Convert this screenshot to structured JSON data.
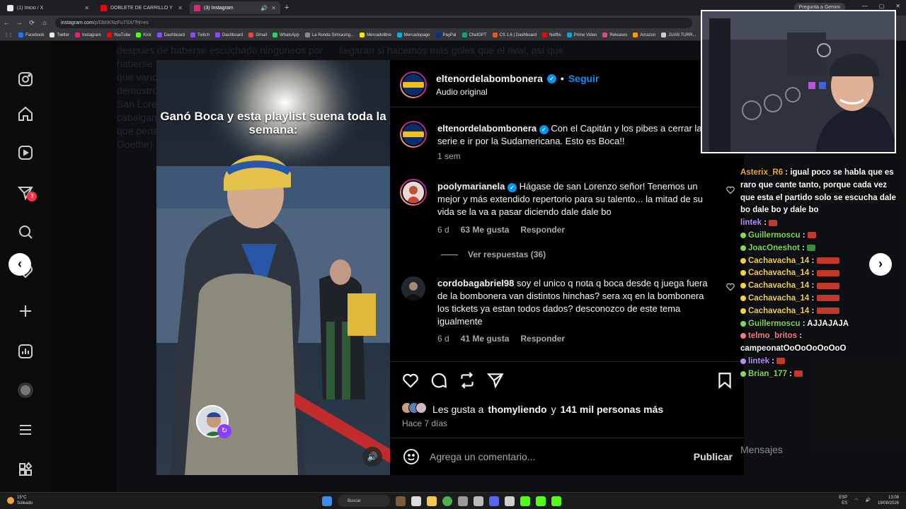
{
  "browser": {
    "tabs": [
      {
        "title": "(1) Inicio / X",
        "color": "#e8e8e8",
        "active": false
      },
      {
        "title": "DOBLETE DE CARRILLO Y GOL...",
        "color": "#ff0000",
        "active": false
      },
      {
        "title": "(3) Instagram",
        "color": "#d62976",
        "active": true
      }
    ],
    "new_tab": "+",
    "gemini_label": "Pregunta a Gemini",
    "address": {
      "host": "instagram.com",
      "path": "/p/DbIIKNzFu7SX/?hl=es"
    },
    "bookmarks": [
      {
        "label": "Facebook",
        "color": "#1877f2"
      },
      {
        "label": "Twitter",
        "color": "#e8e8e8"
      },
      {
        "label": "Instagram",
        "color": "#d62976"
      },
      {
        "label": "YouTube",
        "color": "#ff0000"
      },
      {
        "label": "Kick",
        "color": "#53fc18"
      },
      {
        "label": "Dashboard",
        "color": "#9146ff"
      },
      {
        "label": "Twitch",
        "color": "#9146ff"
      },
      {
        "label": "Dashboard",
        "color": "#9146ff"
      },
      {
        "label": "Gmail",
        "color": "#ea4335"
      },
      {
        "label": "WhatsApp",
        "color": "#25d366"
      },
      {
        "label": "La Ronda Simracing...",
        "color": "#888888"
      },
      {
        "label": "Mercadolibre",
        "color": "#ffe600"
      },
      {
        "label": "Mercadopago",
        "color": "#00b1ea"
      },
      {
        "label": "PayPal",
        "color": "#003087"
      },
      {
        "label": "ChatGPT",
        "color": "#10a37f"
      },
      {
        "label": "CS 1.6 | Dashboard",
        "color": "#e05a2b"
      },
      {
        "label": "Netflix",
        "color": "#e50914"
      },
      {
        "label": "Prime Video",
        "color": "#00a8e1"
      },
      {
        "label": "Releases",
        "color": "#d64a8a"
      },
      {
        "label": "Amazon",
        "color": "#ff9900"
      },
      {
        "label": "JUAN TURR...",
        "color": "#cccccc"
      }
    ]
  },
  "bg_feed": {
    "left_lines": [
      "despues de haberse escuchado ninguneos por",
      "haberse",
      "que vanc",
      "demostro",
      "San Lorer",
      "cabalgan",
      "que perte",
      "Goethe)"
    ],
    "right_lines": [
      "llegaran si hacemos más goles que el rival, así que"
    ]
  },
  "post": {
    "media_caption": "Ganó Boca y esta playlist suena toda la semana:",
    "username": "eltenordelabombonera",
    "dot": "•",
    "follow_label": "Seguir",
    "audio": "Audio original",
    "caption": "Con el Capitán y los pibes a cerrar la serie e ir por la Sudamericana. Esto es Boca!!",
    "caption_time": "1 sem",
    "comments": [
      {
        "user": "poolymarianela",
        "verified": true,
        "text": "Hágase de san Lorenzo señor! Tenemos un mejor y más extendido repertorio para su talento... la mitad de su vida se la va a pasar diciendo dale dale bo",
        "time": "6 d",
        "likes": "63 Me gusta",
        "reply": "Responder",
        "view_replies": "Ver respuestas (36)"
      },
      {
        "user": "cordobagabriel98",
        "verified": false,
        "text": "soy el unico q nota q boca desde q juega fuera de la bombonera van distintos hinchas? sera xq en la bombonera los tickets ya estan todos dados? desconozco de este tema igualmente",
        "time": "6 d",
        "likes": "41 Me gusta",
        "reply": "Responder"
      }
    ],
    "likes_prefix": "Les gusta a",
    "likes_user": "thomyliendo",
    "likes_and": "y",
    "likes_count": "141 mil personas más",
    "posted": "Hace 7 días",
    "comment_placeholder": "Agrega un comentario...",
    "publish": "Publicar"
  },
  "chat": {
    "messages": [
      {
        "user": "Asterix_R6",
        "color": "#f0a830",
        "text": "igual poco se habla que es raro que cante tanto, porque cada vez que esta el partido solo se escucha dale bo dale bo y dale bo"
      },
      {
        "user": "lintek",
        "color": "#b48cf5",
        "text": ""
      },
      {
        "user": "Guillermoscu",
        "color": "#7ed957",
        "text": ""
      },
      {
        "user": "JoacOneshot",
        "color": "#7ed957",
        "text": ""
      },
      {
        "user": "Cachavacha_14",
        "color": "#f5d142",
        "text": ""
      },
      {
        "user": "Cachavacha_14",
        "color": "#f5d142",
        "text": ""
      },
      {
        "user": "Cachavacha_14",
        "color": "#f5d142",
        "text": ""
      },
      {
        "user": "Cachavacha_14",
        "color": "#f5d142",
        "text": ""
      },
      {
        "user": "Cachavacha_14",
        "color": "#f5d142",
        "text": ""
      },
      {
        "user": "Guillermoscu",
        "color": "#7ed957",
        "text": "AJJAJAJA"
      },
      {
        "user": "telmo_britos",
        "color": "#f08080",
        "text": "campeonatOoOoOoOoOoO"
      },
      {
        "user": "lintek",
        "color": "#b48cf5",
        "text": ""
      },
      {
        "user": "Brian_177",
        "color": "#7ed957",
        "text": ""
      }
    ],
    "footer": "Mensajes"
  },
  "taskbar": {
    "temp": "15°C",
    "weather": "Soleado",
    "search": "Buscar",
    "lang_top": "ESP",
    "lang_bottom": "ES",
    "time": "13:08",
    "date": "19/08/2026"
  }
}
